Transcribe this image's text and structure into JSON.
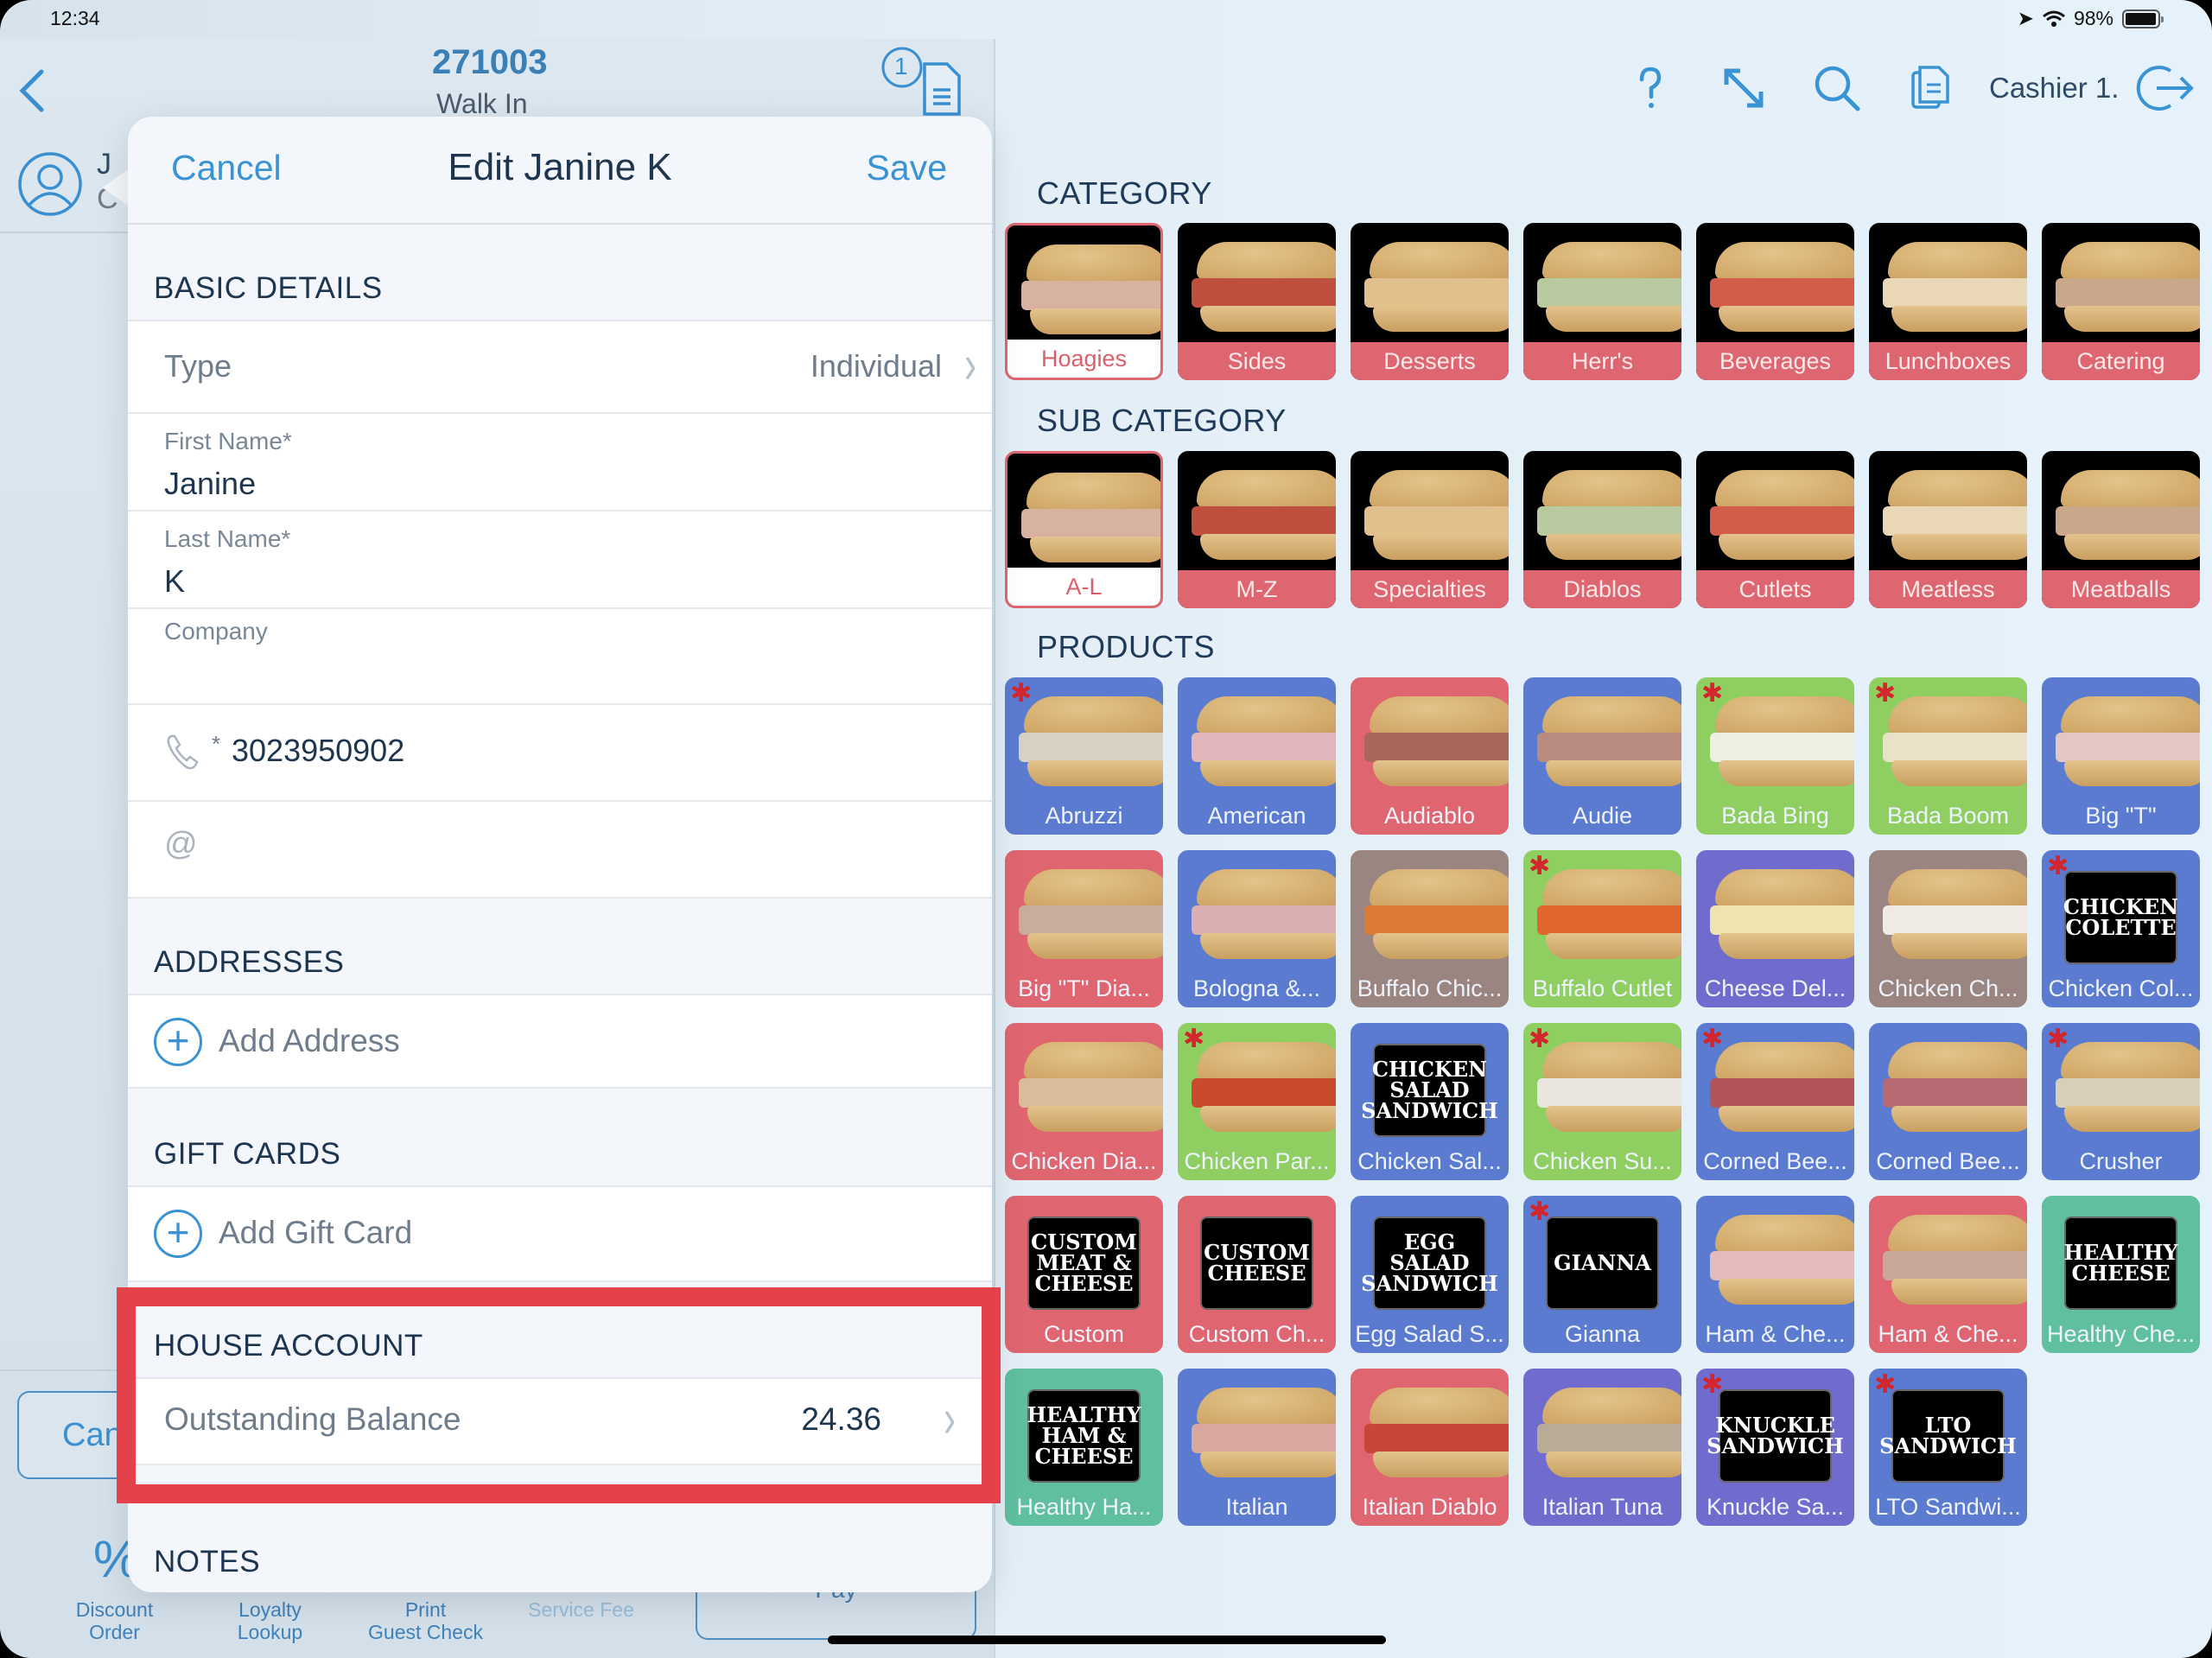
{
  "status_bar": {
    "time": "12:34",
    "battery": "98%",
    "battery_level": 0.98
  },
  "order": {
    "number": "271003",
    "type": "Walk In",
    "ticket_count": "1",
    "customer_initials": "J",
    "customer_sub": "C",
    "cancel_label": "Can",
    "pay_label": "Pay",
    "actions": [
      {
        "label_line1": "Discount",
        "label_line2": "Order",
        "enabled": true
      },
      {
        "label_line1": "Loyalty",
        "label_line2": "Lookup",
        "enabled": true
      },
      {
        "label_line1": "Print",
        "label_line2": "Guest Check",
        "enabled": true
      },
      {
        "label_line1": "",
        "label_line2": "Service Fee",
        "enabled": false
      }
    ]
  },
  "popover": {
    "cancel_label": "Cancel",
    "title": "Edit Janine K",
    "save_label": "Save",
    "basic_details": {
      "heading": "BASIC DETAILS",
      "type_label": "Type",
      "type_value": "Individual",
      "first_name_label": "First Name*",
      "first_name_value": "Janine",
      "last_name_label": "Last Name*",
      "last_name_value": "K",
      "company_label": "Company",
      "company_value": "",
      "phone_required": "*",
      "phone_value": "3023950902",
      "email_value": ""
    },
    "addresses": {
      "heading": "ADDRESSES",
      "add_label": "Add Address"
    },
    "gift_cards": {
      "heading": "GIFT CARDS",
      "add_label": "Add Gift Card"
    },
    "house_account": {
      "heading": "HOUSE ACCOUNT",
      "balance_label": "Outstanding Balance",
      "balance_value": "24.36"
    },
    "notes": {
      "heading": "NOTES"
    }
  },
  "header_right": {
    "cashier": "Cashier 1."
  },
  "catalog": {
    "category_heading": "CATEGORY",
    "subcategory_heading": "SUB CATEGORY",
    "products_heading": "PRODUCTS",
    "categories": [
      {
        "label": "Hoagies",
        "selected": true
      },
      {
        "label": "Sides",
        "selected": false
      },
      {
        "label": "Desserts",
        "selected": false
      },
      {
        "label": "Herr's",
        "selected": false
      },
      {
        "label": "Beverages",
        "selected": false
      },
      {
        "label": "Lunchboxes",
        "selected": false
      },
      {
        "label": "Catering",
        "selected": false
      }
    ],
    "subcategories": [
      {
        "label": "A-L",
        "selected": true
      },
      {
        "label": "M-Z",
        "selected": false
      },
      {
        "label": "Specialties",
        "selected": false
      },
      {
        "label": "Diablos",
        "selected": false
      },
      {
        "label": "Cutlets",
        "selected": false
      },
      {
        "label": "Meatless",
        "selected": false
      },
      {
        "label": "Meatballs",
        "selected": false
      }
    ],
    "products": [
      {
        "label": "Abruzzi",
        "color": "#5b7bd0",
        "star": true,
        "filling": "#d9d0c4",
        "sign": ""
      },
      {
        "label": "American",
        "color": "#5b7bd0",
        "star": false,
        "filling": "#e3b6bb",
        "sign": ""
      },
      {
        "label": "Audiablo",
        "color": "#df6670",
        "star": false,
        "filling": "#a8675a",
        "sign": ""
      },
      {
        "label": "Audie",
        "color": "#5b7bd0",
        "star": false,
        "filling": "#b98a80",
        "sign": ""
      },
      {
        "label": "Bada Bing",
        "color": "#8fcf62",
        "star": true,
        "filling": "#eeeee2",
        "sign": ""
      },
      {
        "label": "Bada Boom",
        "color": "#8fcf62",
        "star": true,
        "filling": "#e9e1c8",
        "sign": ""
      },
      {
        "label": "Big \"T\"",
        "color": "#5b7bd0",
        "star": false,
        "filling": "#e3c7c3",
        "sign": ""
      },
      {
        "label": "Big \"T\" Dia...",
        "color": "#df6670",
        "star": false,
        "filling": "#c7ad9e",
        "sign": ""
      },
      {
        "label": "Bologna &...",
        "color": "#5b7bd0",
        "star": false,
        "filling": "#dbaeb1",
        "sign": ""
      },
      {
        "label": "Buffalo Chic...",
        "color": "#9b8580",
        "star": false,
        "filling": "#df7a35",
        "sign": ""
      },
      {
        "label": "Buffalo Cutlet",
        "color": "#8fcf62",
        "star": true,
        "filling": "#e0662e",
        "sign": ""
      },
      {
        "label": "Cheese Del...",
        "color": "#6f6ccd",
        "star": false,
        "filling": "#efe3b0",
        "sign": ""
      },
      {
        "label": "Chicken Ch...",
        "color": "#9b8580",
        "star": false,
        "filling": "#efebe4",
        "sign": ""
      },
      {
        "label": "Chicken Col...",
        "color": "#5b7bd0",
        "star": true,
        "filling": "",
        "sign": "CHICKEN COLETTE"
      },
      {
        "label": "Chicken Dia...",
        "color": "#df6670",
        "star": false,
        "filling": "#d9bc9a",
        "sign": ""
      },
      {
        "label": "Chicken Par...",
        "color": "#8fcf62",
        "star": true,
        "filling": "#c94b2b",
        "sign": ""
      },
      {
        "label": "Chicken Sal...",
        "color": "#5b7bd0",
        "star": false,
        "filling": "",
        "sign": "CHICKEN SALAD SANDWICH"
      },
      {
        "label": "Chicken Su...",
        "color": "#8fcf62",
        "star": true,
        "filling": "#eae6df",
        "sign": ""
      },
      {
        "label": "Corned Bee...",
        "color": "#5b7bd0",
        "star": true,
        "filling": "#b3535a",
        "sign": ""
      },
      {
        "label": "Corned Bee...",
        "color": "#5b7bd0",
        "star": false,
        "filling": "#b76a72",
        "sign": ""
      },
      {
        "label": "Crusher",
        "color": "#5b7bd0",
        "star": true,
        "filling": "#d7cfb8",
        "sign": ""
      },
      {
        "label": "Custom",
        "color": "#df6670",
        "star": false,
        "filling": "",
        "sign": "CUSTOM MEAT & CHEESE"
      },
      {
        "label": "Custom Ch...",
        "color": "#df6670",
        "star": false,
        "filling": "",
        "sign": "CUSTOM CHEESE"
      },
      {
        "label": "Egg Salad S...",
        "color": "#5b7bd0",
        "star": false,
        "filling": "",
        "sign": "EGG SALAD SANDWICH"
      },
      {
        "label": "Gianna",
        "color": "#5b7bd0",
        "star": true,
        "filling": "",
        "sign": "GIANNA"
      },
      {
        "label": "Ham & Che...",
        "color": "#5b7bd0",
        "star": false,
        "filling": "#e6b9bd",
        "sign": ""
      },
      {
        "label": "Ham & Che...",
        "color": "#df6670",
        "star": false,
        "filling": "#c9a89a",
        "sign": ""
      },
      {
        "label": "Healthy Che...",
        "color": "#5fbf9f",
        "star": false,
        "filling": "",
        "sign": "HEALTHY CHEESE"
      },
      {
        "label": "Healthy Ha...",
        "color": "#5fbf9f",
        "star": false,
        "filling": "",
        "sign": "HEALTHY HAM & CHEESE"
      },
      {
        "label": "Italian",
        "color": "#5b7bd0",
        "star": false,
        "filling": "#d9a7a0",
        "sign": ""
      },
      {
        "label": "Italian Diablo",
        "color": "#df6670",
        "star": false,
        "filling": "#c8453a",
        "sign": ""
      },
      {
        "label": "Italian Tuna",
        "color": "#6f6ccd",
        "star": false,
        "filling": "#b9ab98",
        "sign": ""
      },
      {
        "label": "Knuckle Sa...",
        "color": "#6f6ccd",
        "star": true,
        "filling": "",
        "sign": "KNUCKLE SANDWICH"
      },
      {
        "label": "LTO Sandwi...",
        "color": "#5b7bd0",
        "star": true,
        "filling": "",
        "sign": "LTO SANDWICH"
      }
    ]
  },
  "colors": {
    "accent": "#3a93d2",
    "highlight": "#e5414b",
    "category_caption": "#de6670",
    "text_dark": "#1e3550"
  }
}
